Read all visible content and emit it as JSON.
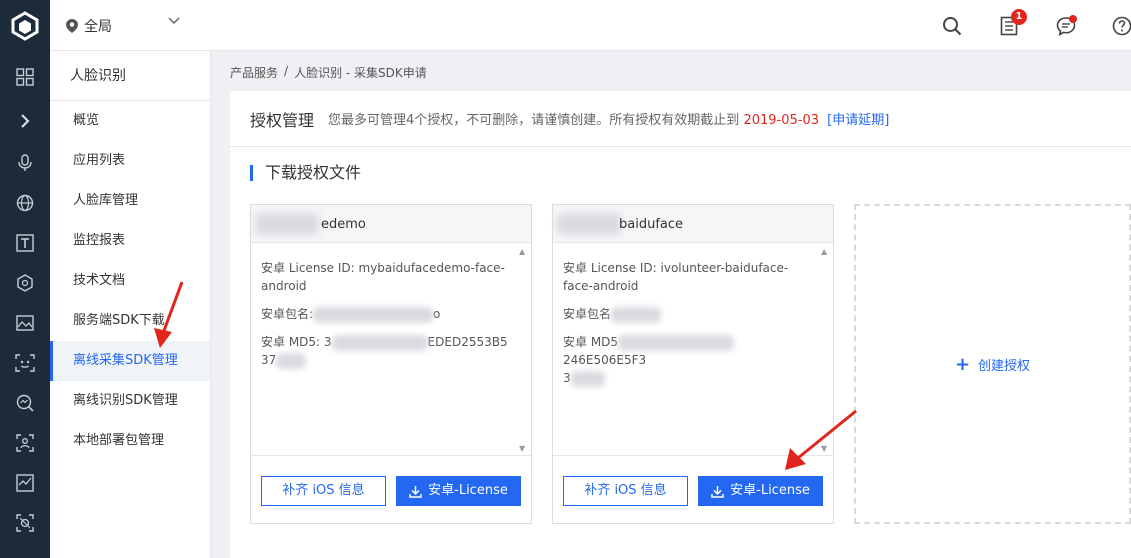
{
  "header": {
    "region_label": "全局",
    "notification_count": "1"
  },
  "subnav": {
    "title": "人脸识别",
    "items": [
      {
        "label": "概览"
      },
      {
        "label": "应用列表"
      },
      {
        "label": "人脸库管理"
      },
      {
        "label": "监控报表"
      },
      {
        "label": "技术文档"
      },
      {
        "label": "服务端SDK下载"
      },
      {
        "label": "离线采集SDK管理",
        "active": true
      },
      {
        "label": "离线识别SDK管理"
      },
      {
        "label": "本地部署包管理"
      }
    ]
  },
  "breadcrumb": {
    "root": "产品服务",
    "sep": "/",
    "current": "人脸识别 - 采集SDK申请"
  },
  "panel": {
    "title": "授权管理",
    "notice_text": "您最多可管理4个授权，不可删除，请谨慎创建。所有授权有效期截止到",
    "notice_date": "2019-05-03",
    "notice_link": "[申请延期]",
    "section_title": "下载授权文件"
  },
  "cards": [
    {
      "name": "edemo",
      "license_id": "安卓 License ID: mybaidufacedemo-face-android",
      "package_label": "安卓包名:",
      "package_tail": "o",
      "md5_label": "安卓 MD5: 3",
      "md5_tail": "EDED2553B5",
      "md5_line2": "37",
      "btn_ios": "补齐 iOS 信息",
      "btn_android": "安卓-License"
    },
    {
      "name": "baiduface",
      "license_id": "安卓 License ID: ivolunteer-baiduface-face-android",
      "package_label": "安卓包名",
      "package_tail": "",
      "md5_label": "安卓 MD5",
      "md5_tail": "246E506E5F3",
      "md5_line2": "3",
      "btn_ios": "补齐 iOS 信息",
      "btn_android": "安卓-License"
    }
  ],
  "create": {
    "label": "创建授权"
  },
  "colors": {
    "accent": "#2468f2",
    "danger": "#e1251b",
    "rail": "#1c2a3a"
  }
}
